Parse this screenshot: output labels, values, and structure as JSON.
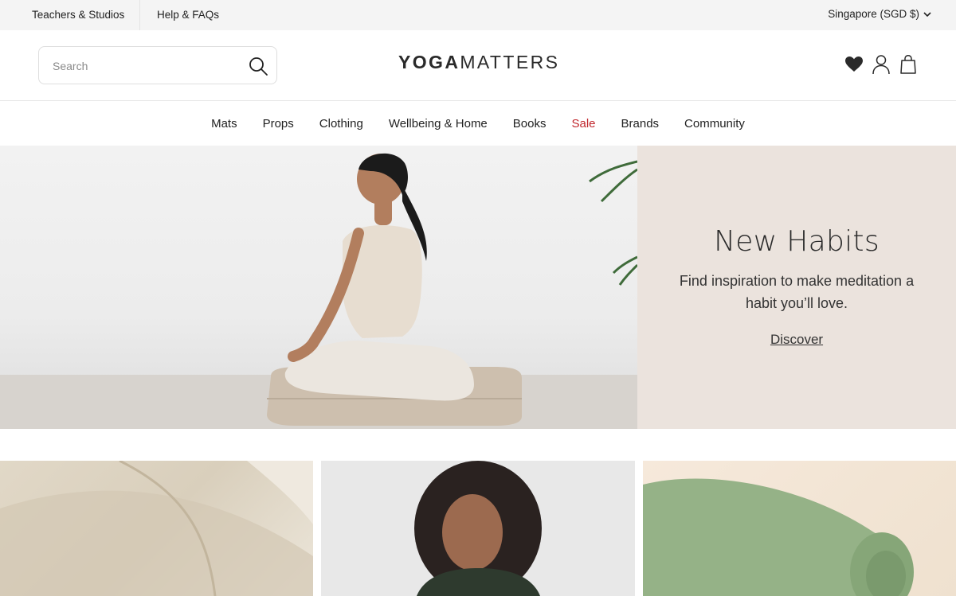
{
  "topbar": {
    "teachers_label": "Teachers & Studios",
    "help_label": "Help & FAQs",
    "region_label": "Singapore (SGD $)"
  },
  "header": {
    "search_placeholder": "Search",
    "logo_bold": "YOGA",
    "logo_light": "MATTERS"
  },
  "nav": {
    "items": [
      "Mats",
      "Props",
      "Clothing",
      "Wellbeing & Home",
      "Books",
      "Sale",
      "Brands",
      "Community"
    ]
  },
  "hero": {
    "title": "New Habits",
    "subtitle": "Find inspiration to make meditation a habit you’ll love.",
    "cta": "Discover",
    "panel_color": "#ebe3dd"
  },
  "colors": {
    "sale": "#c0272d",
    "topbar_bg": "#f4f4f4"
  }
}
